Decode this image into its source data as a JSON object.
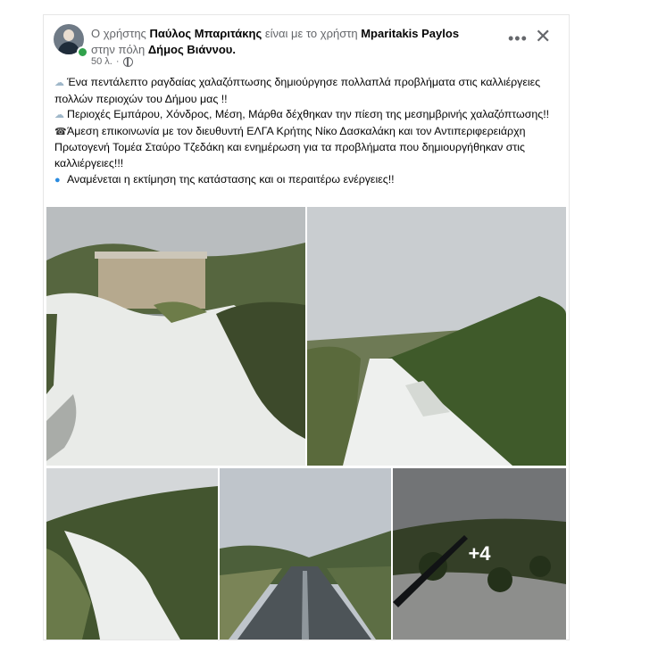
{
  "post": {
    "header_prefix": "Ο χρήστης",
    "author": "Παύλος Μπαριτάκης",
    "with_text": "είναι με το χρήστη",
    "tagged": "Mparitakis Paylos",
    "in_text": "στην πόλη",
    "place": "Δήμος Βιάννου.",
    "time": "50 λ.",
    "menu_icon": "more-icon",
    "close_icon": "close-icon",
    "lines": [
      {
        "emoji": "cloud-hail-emoji",
        "text": "Ένα πεντάλεπτο ραγδαίας χαλαζόπτωσης δημιούργησε πολλαπλά προβλήματα στις καλλιέργειες πολλών περιοχών του Δήμου μας !!"
      },
      {
        "emoji": "cloud-hail-emoji",
        "text": "Περιοχές Εμπάρου, Χόνδρος, Μέση, Μάρθα δέχθηκαν την πίεση της μεσημβρινής χαλαζόπτωσης!!"
      },
      {
        "emoji": "phone-emoji",
        "text": "Άμεση επικοινωνία με τον διευθυντή ΕΛΓΑ Κρήτης Νίκο Δασκαλάκη και τον Αντιπεριφερειάρχη Πρωτογενή Τομέα Σταύρο Τζεδάκη και ενημέρωση για τα προβλήματα που δημιουργήθηκαν στις καλλιέργειες!!!"
      },
      {
        "emoji": "droplet-emoji",
        "text": "Αναμένεται η εκτίμηση της κατάστασης και οι περαιτέρω ενέργειες!!"
      }
    ],
    "more_photos": "+4"
  }
}
